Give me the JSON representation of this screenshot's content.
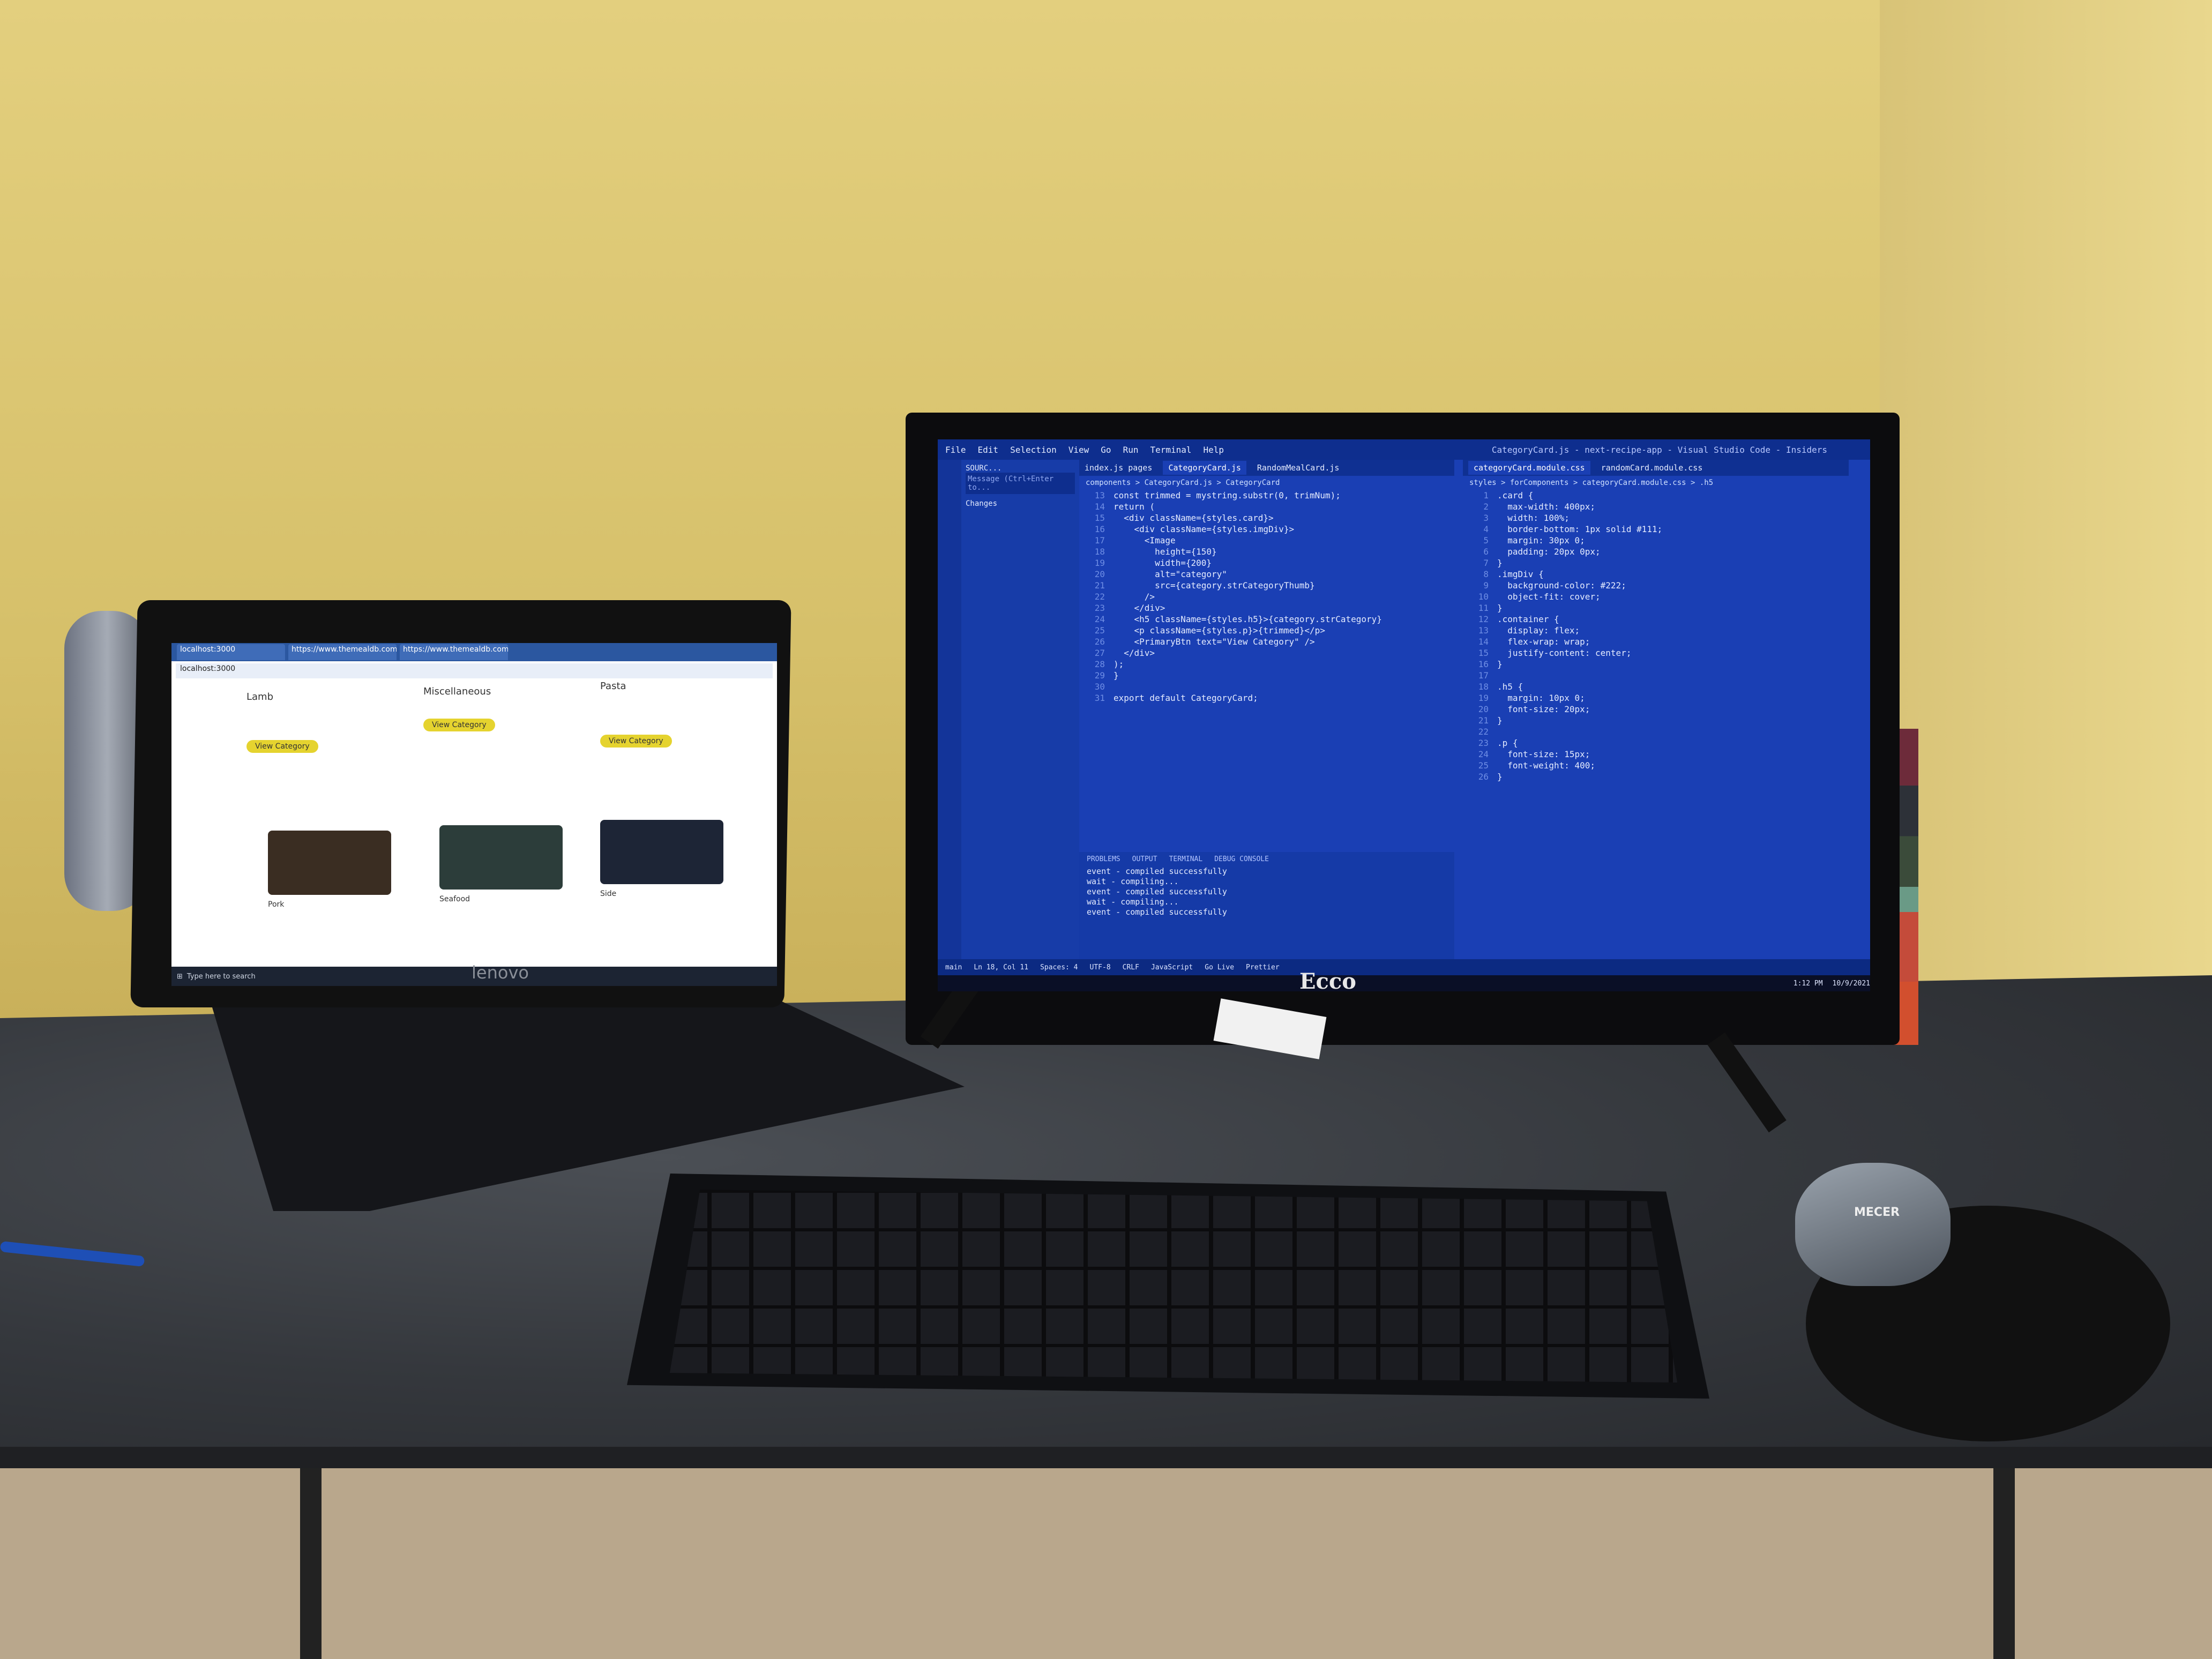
{
  "laptop": {
    "brand": "lenovo",
    "browser_tabs": [
      "localhost:3000",
      "https://www.themealdb.com/a...",
      "https://www.themealdb.com/a..."
    ],
    "address": "localhost:3000",
    "cards": [
      {
        "title": "Lamb",
        "button": "View Category"
      },
      {
        "title": "Miscellaneous",
        "button": "View Category"
      },
      {
        "title": "Pasta",
        "button": "View Category"
      }
    ],
    "second_row_titles": [
      "Pork",
      "Seafood",
      "Side"
    ],
    "taskbar_search": "Type here to search"
  },
  "monitor": {
    "brand": "Ecco",
    "title": "CategoryCard.js - next-recipe-app - Visual Studio Code - Insiders",
    "menu": [
      "File",
      "Edit",
      "Selection",
      "View",
      "Go",
      "Run",
      "Terminal",
      "Help"
    ],
    "sidebar": {
      "header": "SOURC...",
      "message_placeholder": "Message (Ctrl+Enter to...",
      "changes": "Changes"
    },
    "editor_left": {
      "tabs": [
        "index.js pages",
        "CategoryCard.js",
        "RandomMealCard.js"
      ],
      "breadcrumb": "components > CategoryCard.js > CategoryCard",
      "lines": [
        {
          "n": "13",
          "t": "const trimmed = mystring.substr(0, trimNum);"
        },
        {
          "n": "14",
          "t": "return ("
        },
        {
          "n": "15",
          "t": "  <div className={styles.card}>"
        },
        {
          "n": "16",
          "t": "    <div className={styles.imgDiv}>"
        },
        {
          "n": "17",
          "t": "      <Image"
        },
        {
          "n": "18",
          "t": "        height={150}"
        },
        {
          "n": "19",
          "t": "        width={200}"
        },
        {
          "n": "20",
          "t": "        alt=\"category\""
        },
        {
          "n": "21",
          "t": "        src={category.strCategoryThumb}"
        },
        {
          "n": "22",
          "t": "      />"
        },
        {
          "n": "23",
          "t": "    </div>"
        },
        {
          "n": "24",
          "t": "    <h5 className={styles.h5}>{category.strCategory}"
        },
        {
          "n": "25",
          "t": "    <p className={styles.p}>{trimmed}</p>"
        },
        {
          "n": "26",
          "t": "    <PrimaryBtn text=\"View Category\" />"
        },
        {
          "n": "27",
          "t": "  </div>"
        },
        {
          "n": "28",
          "t": ");"
        },
        {
          "n": "29",
          "t": "}"
        },
        {
          "n": "30",
          "t": ""
        },
        {
          "n": "31",
          "t": "export default CategoryCard;"
        }
      ]
    },
    "editor_right": {
      "tabs": [
        "categoryCard.module.css",
        "randomCard.module.css"
      ],
      "breadcrumb": "styles > forComponents > categoryCard.module.css > .h5",
      "lines": [
        {
          "n": "1",
          "t": ".card {"
        },
        {
          "n": "2",
          "t": "  max-width: 400px;"
        },
        {
          "n": "3",
          "t": "  width: 100%;"
        },
        {
          "n": "4",
          "t": "  border-bottom: 1px solid #111;"
        },
        {
          "n": "5",
          "t": "  margin: 30px 0;"
        },
        {
          "n": "6",
          "t": "  padding: 20px 0px;"
        },
        {
          "n": "7",
          "t": "}"
        },
        {
          "n": "8",
          "t": ".imgDiv {"
        },
        {
          "n": "9",
          "t": "  background-color: #222;"
        },
        {
          "n": "10",
          "t": "  object-fit: cover;"
        },
        {
          "n": "11",
          "t": "}"
        },
        {
          "n": "12",
          "t": ".container {"
        },
        {
          "n": "13",
          "t": "  display: flex;"
        },
        {
          "n": "14",
          "t": "  flex-wrap: wrap;"
        },
        {
          "n": "15",
          "t": "  justify-content: center;"
        },
        {
          "n": "16",
          "t": "}"
        },
        {
          "n": "17",
          "t": ""
        },
        {
          "n": "18",
          "t": ".h5 {"
        },
        {
          "n": "19",
          "t": "  margin: 10px 0;"
        },
        {
          "n": "20",
          "t": "  font-size: 20px;"
        },
        {
          "n": "21",
          "t": "}"
        },
        {
          "n": "22",
          "t": ""
        },
        {
          "n": "23",
          "t": ".p {"
        },
        {
          "n": "24",
          "t": "  font-size: 15px;"
        },
        {
          "n": "25",
          "t": "  font-weight: 400;"
        },
        {
          "n": "26",
          "t": "}"
        }
      ]
    },
    "terminal": {
      "tabs": [
        "PROBLEMS",
        "OUTPUT",
        "TERMINAL",
        "DEBUG CONSOLE"
      ],
      "lines": [
        "event - compiled successfully",
        "wait  - compiling...",
        "event - compiled successfully",
        "wait  - compiling...",
        "event - compiled successfully"
      ]
    },
    "statusbar": [
      "main",
      "Ln 18, Col 11",
      "Spaces: 4",
      "UTF-8",
      "CRLF",
      "JavaScript",
      "Go Live",
      "Prettier"
    ],
    "clock": {
      "time": "1:12 PM",
      "date": "10/9/2021"
    }
  },
  "peripherals": {
    "mouse_brand": "MECER"
  },
  "colors": {
    "editor_bg": "#1a3fb4",
    "wall": "#e3cf7e",
    "desk": "#35383d",
    "button_yellow": "#e5d32f"
  }
}
